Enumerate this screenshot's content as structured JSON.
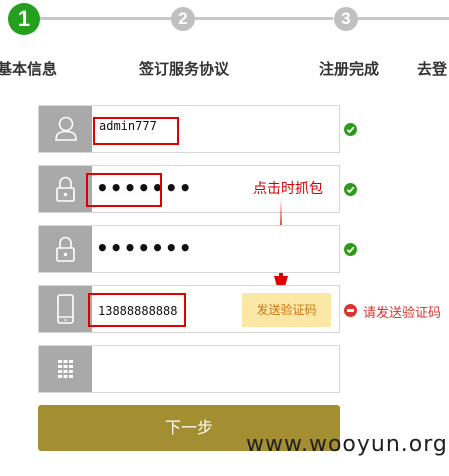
{
  "steps": [
    {
      "number": "1",
      "label": "基本信息",
      "state": "active"
    },
    {
      "number": "2",
      "label": "签订服务协议",
      "state": "inactive"
    },
    {
      "number": "3",
      "label": "注册完成",
      "state": "inactive"
    },
    {
      "number": "",
      "label": "去登",
      "state": "inactive"
    }
  ],
  "form": {
    "username": {
      "value": "admin777",
      "icon": "user-icon",
      "status": "valid"
    },
    "password": {
      "value": "•••••••",
      "icon": "lock-icon",
      "status": "valid"
    },
    "confirm_password": {
      "value": "•••••••",
      "icon": "lock-icon",
      "status": "valid"
    },
    "phone": {
      "value": "13888888888",
      "icon": "phone-icon",
      "status": "error"
    },
    "sms_code": {
      "value": "",
      "icon": "keypad-icon"
    }
  },
  "send_code_button": "发送验证码",
  "phone_error": "请发送验证码",
  "annotation": "点击时抓包",
  "next_button": "下一步",
  "watermark": "www.wooyun.org",
  "colors": {
    "active_step": "#24a01e",
    "inactive_step": "#c8c8c8",
    "icon_bg": "#a9a9a9",
    "valid": "#2e9a1c",
    "error": "#d9342b",
    "annotation": "#e00000",
    "send_code_bg": "#fbe8a6",
    "next_bg": "#a38e31"
  }
}
